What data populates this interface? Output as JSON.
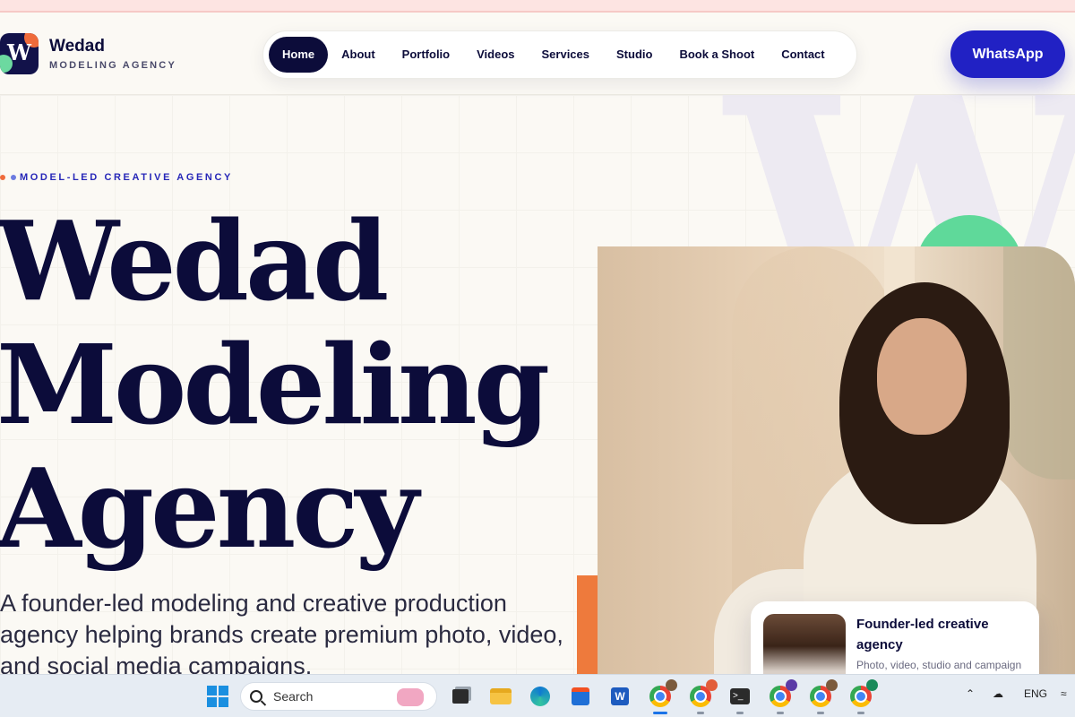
{
  "brand": {
    "logo_letter": "W",
    "name": "Wedad",
    "tagline": "MODELING AGENCY"
  },
  "nav": {
    "items": [
      "Home",
      "About",
      "Portfolio",
      "Videos",
      "Services",
      "Studio",
      "Book a Shoot",
      "Contact"
    ],
    "active": "Home"
  },
  "cta": {
    "whatsapp": "WhatsApp"
  },
  "hero": {
    "eyebrow": "MODEL-LED CREATIVE AGENCY",
    "title_lines": [
      "Wedad",
      "Modeling",
      "Agency"
    ],
    "description": "A founder-led modeling and creative production agency helping brands create premium photo, video, and social media campaigns.",
    "watermark": "W"
  },
  "founder_card": {
    "title": "Founder-led creative agency",
    "subtitle": "Photo, video, studio and campaign"
  },
  "taskbar": {
    "search_label": "Search",
    "language": "ENG",
    "apps": [
      "windows-start",
      "search",
      "task-view",
      "file-explorer",
      "edge",
      "microsoft-store",
      "word",
      "chrome",
      "chrome",
      "terminal",
      "chrome",
      "chrome",
      "chrome"
    ]
  },
  "colors": {
    "navy": "#0c0c3a",
    "primary_blue": "#2121c4",
    "orange": "#ef6b3b",
    "green": "#5fd99a",
    "background": "#fbf9f4"
  }
}
